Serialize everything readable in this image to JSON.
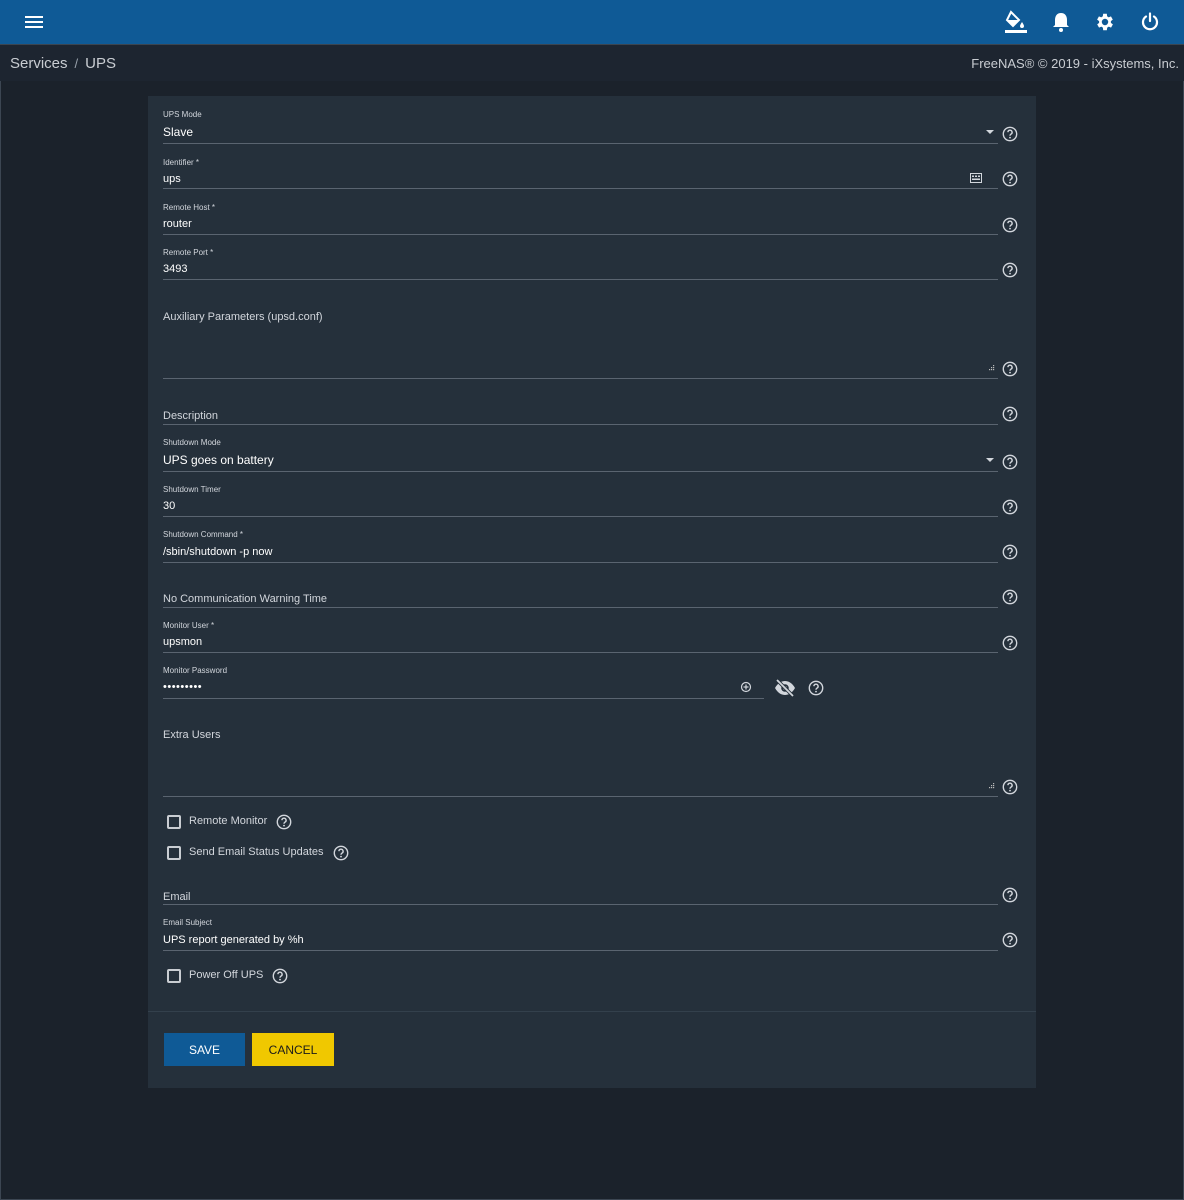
{
  "topbar": {
    "menu_icon": "hamburger-menu-icon",
    "theme_icon": "paint-bucket-icon",
    "alerts_icon": "bell-icon",
    "settings_icon": "gear-icon",
    "power_icon": "power-icon",
    "background_color": "#0f5a96"
  },
  "breadcrumb": {
    "parent": "Services",
    "separator": "/",
    "current": "UPS"
  },
  "copyright": "FreeNAS® © 2019 - iXsystems, Inc.",
  "form": {
    "ups_mode": {
      "label": "UPS Mode",
      "value": "Slave"
    },
    "identifier": {
      "label": "Identifier *",
      "value": "ups"
    },
    "remote_host": {
      "label": "Remote Host *",
      "value": "router"
    },
    "remote_port": {
      "label": "Remote Port *",
      "value": "3493"
    },
    "aux_params": {
      "placeholder": "Auxiliary Parameters (upsd.conf)",
      "value": ""
    },
    "description": {
      "placeholder": "Description",
      "value": ""
    },
    "shutdown_mode": {
      "label": "Shutdown Mode",
      "value": "UPS goes on battery"
    },
    "shutdown_timer": {
      "label": "Shutdown Timer",
      "value": "30"
    },
    "shutdown_command": {
      "label": "Shutdown Command *",
      "value": "/sbin/shutdown -p now"
    },
    "no_comm_warning": {
      "placeholder": "No Communication Warning Time",
      "value": ""
    },
    "monitor_user": {
      "label": "Monitor User *",
      "value": "upsmon"
    },
    "monitor_password": {
      "label": "Monitor Password",
      "value": "•••••••••"
    },
    "extra_users": {
      "placeholder": "Extra Users",
      "value": ""
    },
    "remote_monitor": {
      "label": "Remote Monitor",
      "checked": false
    },
    "send_email": {
      "label": "Send Email Status Updates",
      "checked": false
    },
    "email": {
      "placeholder": "Email",
      "value": ""
    },
    "email_subject": {
      "label": "Email Subject",
      "value": "UPS report generated by %h"
    },
    "power_off_ups": {
      "label": "Power Off UPS",
      "checked": false
    }
  },
  "buttons": {
    "save": "SAVE",
    "cancel": "CANCEL",
    "save_color": "#0f5a96",
    "cancel_color": "#f0c800"
  }
}
